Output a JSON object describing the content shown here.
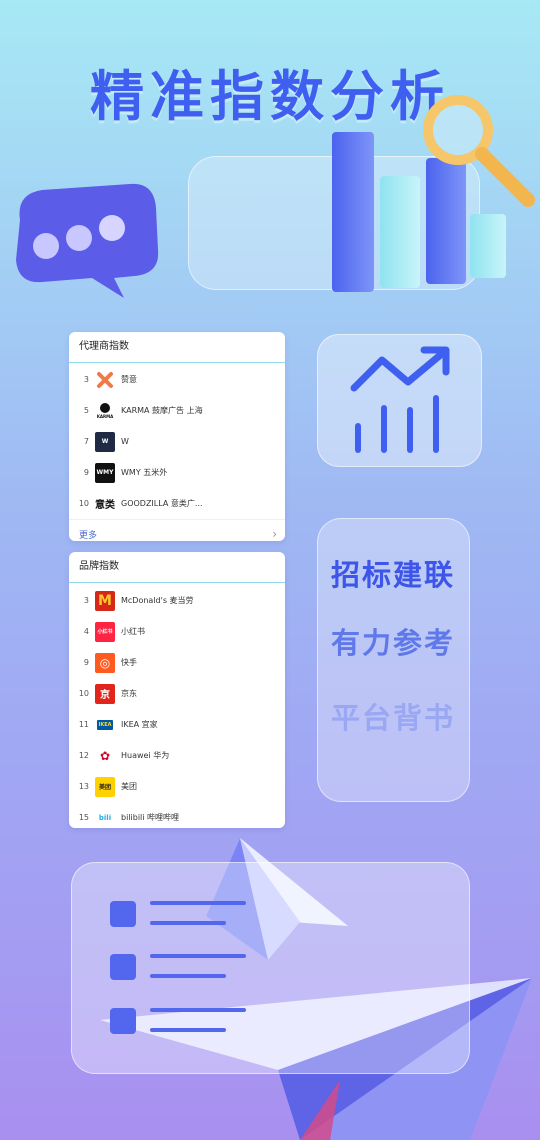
{
  "hero": {
    "title": "精准指数分析"
  },
  "agency_index": {
    "title": "代理商指数",
    "more_label": "更多",
    "items": [
      {
        "rank": "3",
        "name": "赞意",
        "logo_text": "",
        "logo_color": "#ffffff"
      },
      {
        "rank": "5",
        "name": "KARMA 鼓摩广告 上海",
        "logo_text": "KARMA",
        "logo_color": "#ffffff"
      },
      {
        "rank": "7",
        "name": "W",
        "logo_text": "W",
        "logo_color": "#1f2a44"
      },
      {
        "rank": "9",
        "name": "WMY 五米外",
        "logo_text": "WMY",
        "logo_color": "#111111"
      },
      {
        "rank": "10",
        "name": "GOODZILLA 意类广...",
        "logo_text": "意类",
        "logo_color": "#ffffff"
      }
    ]
  },
  "brand_index": {
    "title": "品牌指数",
    "items": [
      {
        "rank": "3",
        "name": "McDonald's 麦当劳",
        "logo_text": "M",
        "logo_color": "#d62718"
      },
      {
        "rank": "4",
        "name": "小红书",
        "logo_text": "小红书",
        "logo_color": "#ff2442"
      },
      {
        "rank": "9",
        "name": "快手",
        "logo_text": "◎",
        "logo_color": "#ff5a1f"
      },
      {
        "rank": "10",
        "name": "京东",
        "logo_text": "京",
        "logo_color": "#e1251b"
      },
      {
        "rank": "11",
        "name": "IKEA 宜家",
        "logo_text": "IKEA",
        "logo_color": "#ffffff"
      },
      {
        "rank": "12",
        "name": "Huawei 华为",
        "logo_text": "✿",
        "logo_color": "#ffffff"
      },
      {
        "rank": "13",
        "name": "美团",
        "logo_text": "美团",
        "logo_color": "#ffd100"
      },
      {
        "rank": "15",
        "name": "bilibili 哔哩哔哩",
        "logo_text": "bili",
        "logo_color": "#ffffff"
      }
    ]
  },
  "slogans": [
    "招标建联",
    "有力参考",
    "平台背书"
  ],
  "colors": {
    "accent": "#3f5ff0",
    "slogan_1": "#3d55e8",
    "slogan_2": "#5f78ea",
    "slogan_3": "#9aa7f2"
  },
  "icons": [
    "chat-bubble-icon",
    "bar-chart-3d-icon",
    "magnifier-icon",
    "trend-chart-icon",
    "list-icon",
    "paper-plane-icon"
  ]
}
